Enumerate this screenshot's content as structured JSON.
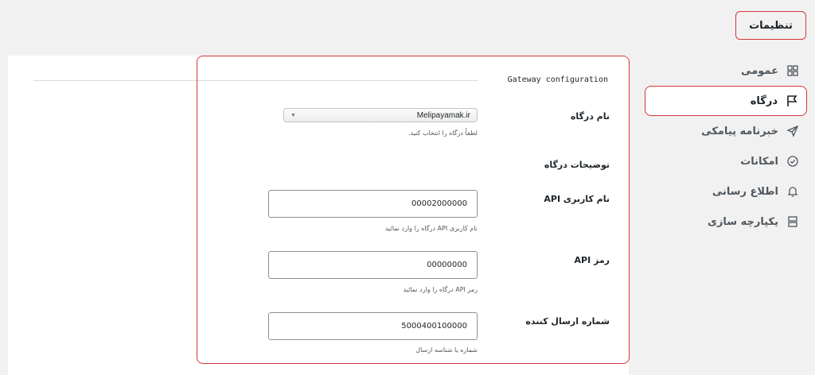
{
  "page": {
    "title": "تنظیمات"
  },
  "sidebar": {
    "items": [
      {
        "label": "عمومی",
        "icon": "grid-icon",
        "active": false
      },
      {
        "label": "درگاه",
        "icon": "flag-icon",
        "active": true
      },
      {
        "label": "خبرنامه پیامکی",
        "icon": "send-icon",
        "active": false
      },
      {
        "label": "امکانات",
        "icon": "check-circle-icon",
        "active": false
      },
      {
        "label": "اطلاع رسانی",
        "icon": "bell-icon",
        "active": false
      },
      {
        "label": "یکپارچه سازی",
        "icon": "integration-icon",
        "active": false
      }
    ]
  },
  "gateway": {
    "section_title": "Gateway configuration",
    "name_label": "نام درگاه",
    "name_value": "Melipayamak.ir",
    "name_help": "لطفاً درگاه را انتخاب کنید.",
    "description_label": "توضیحات درگاه",
    "username_label": "نام کاربری API",
    "username_value": "00002000000",
    "username_help": "نام کاربری API درگاه را وارد نمائید",
    "password_label": "رمز API",
    "password_value": "00000000",
    "password_help": "رمز API درگاه را وارد نمائید",
    "sender_label": "شماره ارسال کننده",
    "sender_value": "5000400100000",
    "sender_help": "شماره یا شناسه ارسال"
  },
  "colors": {
    "highlight": "#d63638",
    "panel": "#ffffff",
    "background": "#f1f1f1"
  }
}
